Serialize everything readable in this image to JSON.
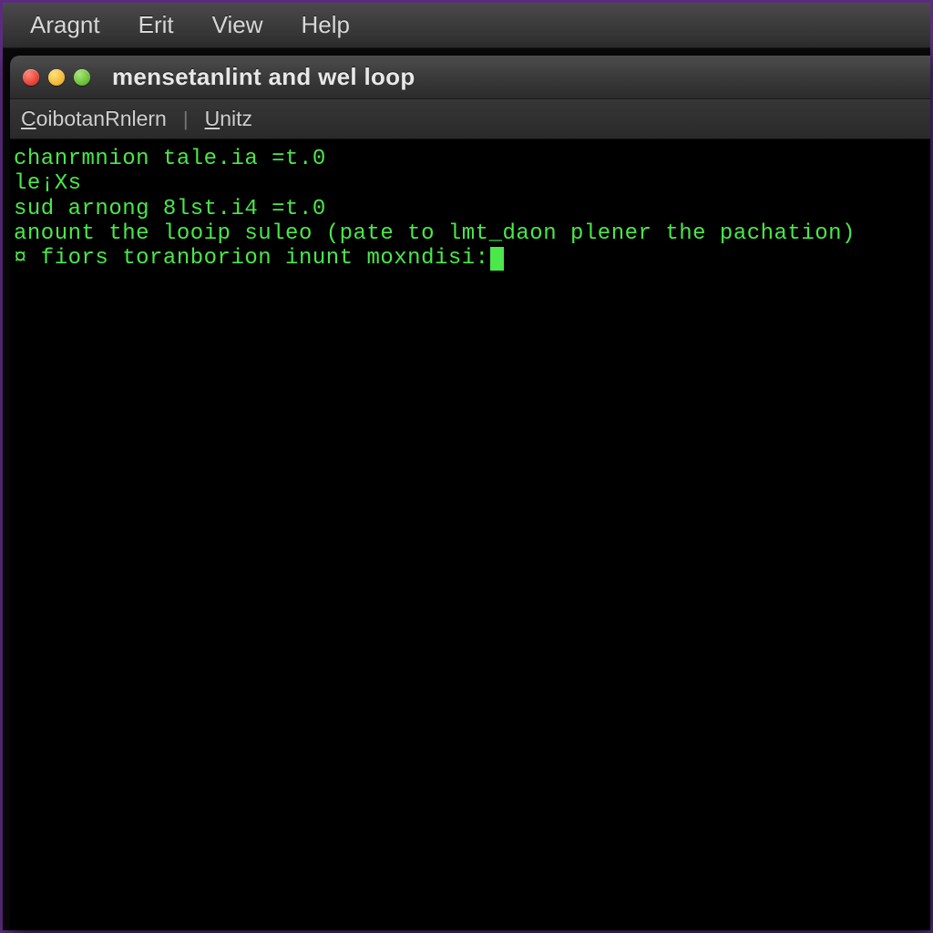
{
  "menubar": {
    "items": [
      "Aragnt",
      "Erit",
      "View",
      "Help"
    ]
  },
  "window": {
    "title": "mensetanlint and wel loop"
  },
  "tabs": {
    "items": [
      {
        "accel": "C",
        "rest": "oibotanRnlern"
      },
      {
        "accel": "U",
        "rest": "nitz"
      }
    ]
  },
  "terminal": {
    "lines": [
      "chanrmnion tale.ia =t.0",
      "le¡Xs",
      "sud arnong 8lst.i4 =t.0",
      "anount the looip suleo (pate to lmt_daon plener the pachation)"
    ],
    "prompt_symbol": "¤",
    "prompt_text": " fiors toranborion inunt moxndisi:"
  }
}
